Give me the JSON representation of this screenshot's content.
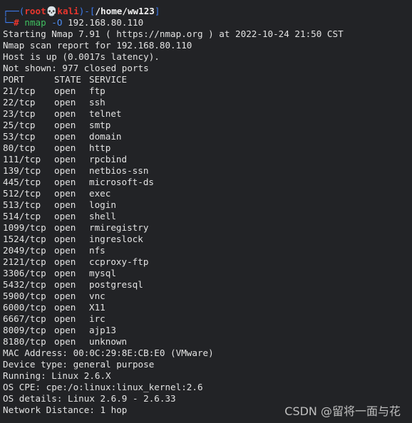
{
  "prompt": {
    "user": "root",
    "skull_glyph": "💀",
    "host": "kali",
    "path": "/home/ww123",
    "symbol": "#",
    "command": "nmap",
    "flag": "-O",
    "target": "192.168.80.110"
  },
  "output": {
    "start_line": "Starting Nmap 7.91 ( https://nmap.org ) at 2022-10-24 21:50 CST",
    "report_line": "Nmap scan report for 192.168.80.110",
    "host_up_line": "Host is up (0.0017s latency).",
    "not_shown_line": "Not shown: 977 closed ports",
    "headers": {
      "port": "PORT",
      "state": "STATE",
      "service": "SERVICE"
    },
    "ports": [
      {
        "port": "21/tcp",
        "state": "open",
        "service": "ftp"
      },
      {
        "port": "22/tcp",
        "state": "open",
        "service": "ssh"
      },
      {
        "port": "23/tcp",
        "state": "open",
        "service": "telnet"
      },
      {
        "port": "25/tcp",
        "state": "open",
        "service": "smtp"
      },
      {
        "port": "53/tcp",
        "state": "open",
        "service": "domain"
      },
      {
        "port": "80/tcp",
        "state": "open",
        "service": "http"
      },
      {
        "port": "111/tcp",
        "state": "open",
        "service": "rpcbind"
      },
      {
        "port": "139/tcp",
        "state": "open",
        "service": "netbios-ssn"
      },
      {
        "port": "445/tcp",
        "state": "open",
        "service": "microsoft-ds"
      },
      {
        "port": "512/tcp",
        "state": "open",
        "service": "exec"
      },
      {
        "port": "513/tcp",
        "state": "open",
        "service": "login"
      },
      {
        "port": "514/tcp",
        "state": "open",
        "service": "shell"
      },
      {
        "port": "1099/tcp",
        "state": "open",
        "service": "rmiregistry"
      },
      {
        "port": "1524/tcp",
        "state": "open",
        "service": "ingreslock"
      },
      {
        "port": "2049/tcp",
        "state": "open",
        "service": "nfs"
      },
      {
        "port": "2121/tcp",
        "state": "open",
        "service": "ccproxy-ftp"
      },
      {
        "port": "3306/tcp",
        "state": "open",
        "service": "mysql"
      },
      {
        "port": "5432/tcp",
        "state": "open",
        "service": "postgresql"
      },
      {
        "port": "5900/tcp",
        "state": "open",
        "service": "vnc"
      },
      {
        "port": "6000/tcp",
        "state": "open",
        "service": "X11"
      },
      {
        "port": "6667/tcp",
        "state": "open",
        "service": "irc"
      },
      {
        "port": "8009/tcp",
        "state": "open",
        "service": "ajp13"
      },
      {
        "port": "8180/tcp",
        "state": "open",
        "service": "unknown"
      }
    ],
    "mac_line": "MAC Address: 00:0C:29:8E:CB:E0 (VMware)",
    "device_type_line": "Device type: general purpose",
    "running_line": "Running: Linux 2.6.X",
    "os_cpe_line": "OS CPE: cpe:/o:linux:linux_kernel:2.6",
    "os_details_line": "OS details: Linux 2.6.9 - 2.6.33",
    "network_distance_line": "Network Distance: 1 hop"
  },
  "watermark": "CSDN @留将一面与花",
  "colors": {
    "background": "#222326",
    "prompt_frame": "#3e7cf0",
    "prompt_user": "#e8362e",
    "command": "#3fbf5f",
    "text": "#e3e3e3"
  }
}
